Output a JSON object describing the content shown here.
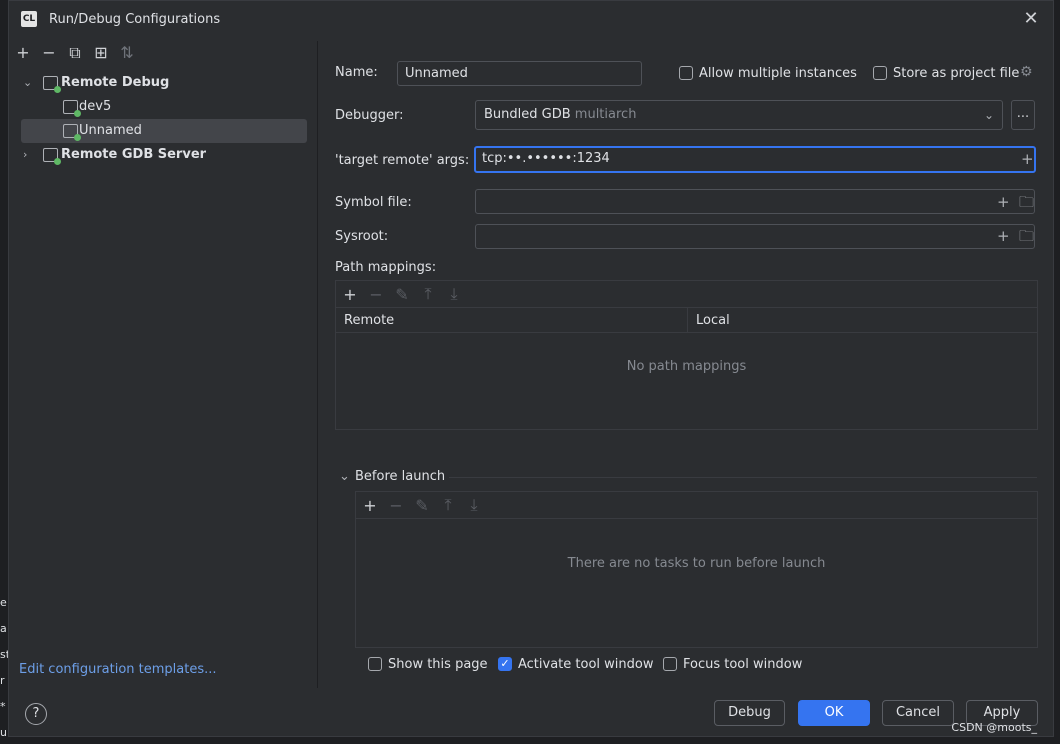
{
  "window": {
    "app_icon": "CL",
    "title": "Run/Debug Configurations",
    "close_icon": "close-icon"
  },
  "left_toolbar": [
    "add-icon",
    "remove-icon",
    "copy-icon",
    "new-folder-icon",
    "sort-icon"
  ],
  "tree": {
    "items": [
      {
        "label": "Remote Debug",
        "expanded": true
      },
      {
        "label": "dev5"
      },
      {
        "label": "Unnamed",
        "selected": true
      },
      {
        "label": "Remote GDB Server",
        "expanded": false
      }
    ]
  },
  "edit_templates_link": "Edit configuration templates...",
  "form": {
    "name_label": "Name:",
    "name_value": "Unnamed",
    "allow_multiple_label": "Allow multiple instances",
    "allow_multiple_checked": false,
    "store_project_label": "Store as project file",
    "store_project_checked": false,
    "debugger_label": "Debugger:",
    "debugger_value": "Bundled GDB",
    "debugger_sub": "multiarch",
    "debugger_more": "...",
    "target_remote_label": "'target remote' args:",
    "target_remote_value": "tcp:••.••••••:1234",
    "symbol_file_label": "Symbol file:",
    "symbol_file_value": "",
    "sysroot_label": "Sysroot:",
    "sysroot_value": "",
    "path_mappings_label": "Path mappings:",
    "path_mappings_columns": [
      "Remote",
      "Local"
    ],
    "path_mappings_empty": "No path mappings",
    "before_launch_label": "Before launch",
    "before_launch_empty": "There are no tasks to run before launch",
    "show_page_label": "Show this page",
    "show_page_checked": false,
    "activate_tool_label": "Activate tool window",
    "activate_tool_checked": true,
    "focus_tool_label": "Focus tool window",
    "focus_tool_checked": false
  },
  "buttons": {
    "debug": "Debug",
    "ok": "OK",
    "cancel": "Cancel",
    "apply": "Apply",
    "help": "?"
  },
  "watermark": "CSDN @moots_",
  "colors": {
    "accent": "#3574f0",
    "dialog_bg": "#2b2d30",
    "link": "#6d9fe8"
  }
}
